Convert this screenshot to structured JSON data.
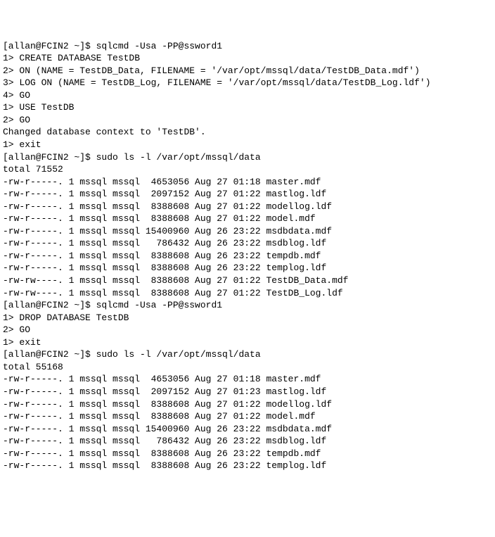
{
  "lines": [
    "[allan@FCIN2 ~]$ sqlcmd -Usa -PP@ssword1",
    "1> CREATE DATABASE TestDB",
    "2> ON (NAME = TestDB_Data, FILENAME = '/var/opt/mssql/data/TestDB_Data.mdf')",
    "3> LOG ON (NAME = TestDB_Log, FILENAME = '/var/opt/mssql/data/TestDB_Log.ldf')",
    "4> GO",
    "1> USE TestDB",
    "2> GO",
    "Changed database context to 'TestDB'.",
    "1> exit",
    "[allan@FCIN2 ~]$ sudo ls -l /var/opt/mssql/data",
    "total 71552",
    "-rw-r-----. 1 mssql mssql  4653056 Aug 27 01:18 master.mdf",
    "-rw-r-----. 1 mssql mssql  2097152 Aug 27 01:22 mastlog.ldf",
    "-rw-r-----. 1 mssql mssql  8388608 Aug 27 01:22 modellog.ldf",
    "-rw-r-----. 1 mssql mssql  8388608 Aug 27 01:22 model.mdf",
    "-rw-r-----. 1 mssql mssql 15400960 Aug 26 23:22 msdbdata.mdf",
    "-rw-r-----. 1 mssql mssql   786432 Aug 26 23:22 msdblog.ldf",
    "-rw-r-----. 1 mssql mssql  8388608 Aug 26 23:22 tempdb.mdf",
    "-rw-r-----. 1 mssql mssql  8388608 Aug 26 23:22 templog.ldf",
    "-rw-rw----. 1 mssql mssql  8388608 Aug 27 01:22 TestDB_Data.mdf",
    "-rw-rw----. 1 mssql mssql  8388608 Aug 27 01:22 TestDB_Log.ldf",
    "[allan@FCIN2 ~]$ sqlcmd -Usa -PP@ssword1",
    "1> DROP DATABASE TestDB",
    "2> GO",
    "1> exit",
    "[allan@FCIN2 ~]$ sudo ls -l /var/opt/mssql/data",
    "total 55168",
    "-rw-r-----. 1 mssql mssql  4653056 Aug 27 01:18 master.mdf",
    "-rw-r-----. 1 mssql mssql  2097152 Aug 27 01:23 mastlog.ldf",
    "-rw-r-----. 1 mssql mssql  8388608 Aug 27 01:22 modellog.ldf",
    "-rw-r-----. 1 mssql mssql  8388608 Aug 27 01:22 model.mdf",
    "-rw-r-----. 1 mssql mssql 15400960 Aug 26 23:22 msdbdata.mdf",
    "-rw-r-----. 1 mssql mssql   786432 Aug 26 23:22 msdblog.ldf",
    "-rw-r-----. 1 mssql mssql  8388608 Aug 26 23:22 tempdb.mdf",
    "-rw-r-----. 1 mssql mssql  8388608 Aug 26 23:22 templog.ldf"
  ]
}
